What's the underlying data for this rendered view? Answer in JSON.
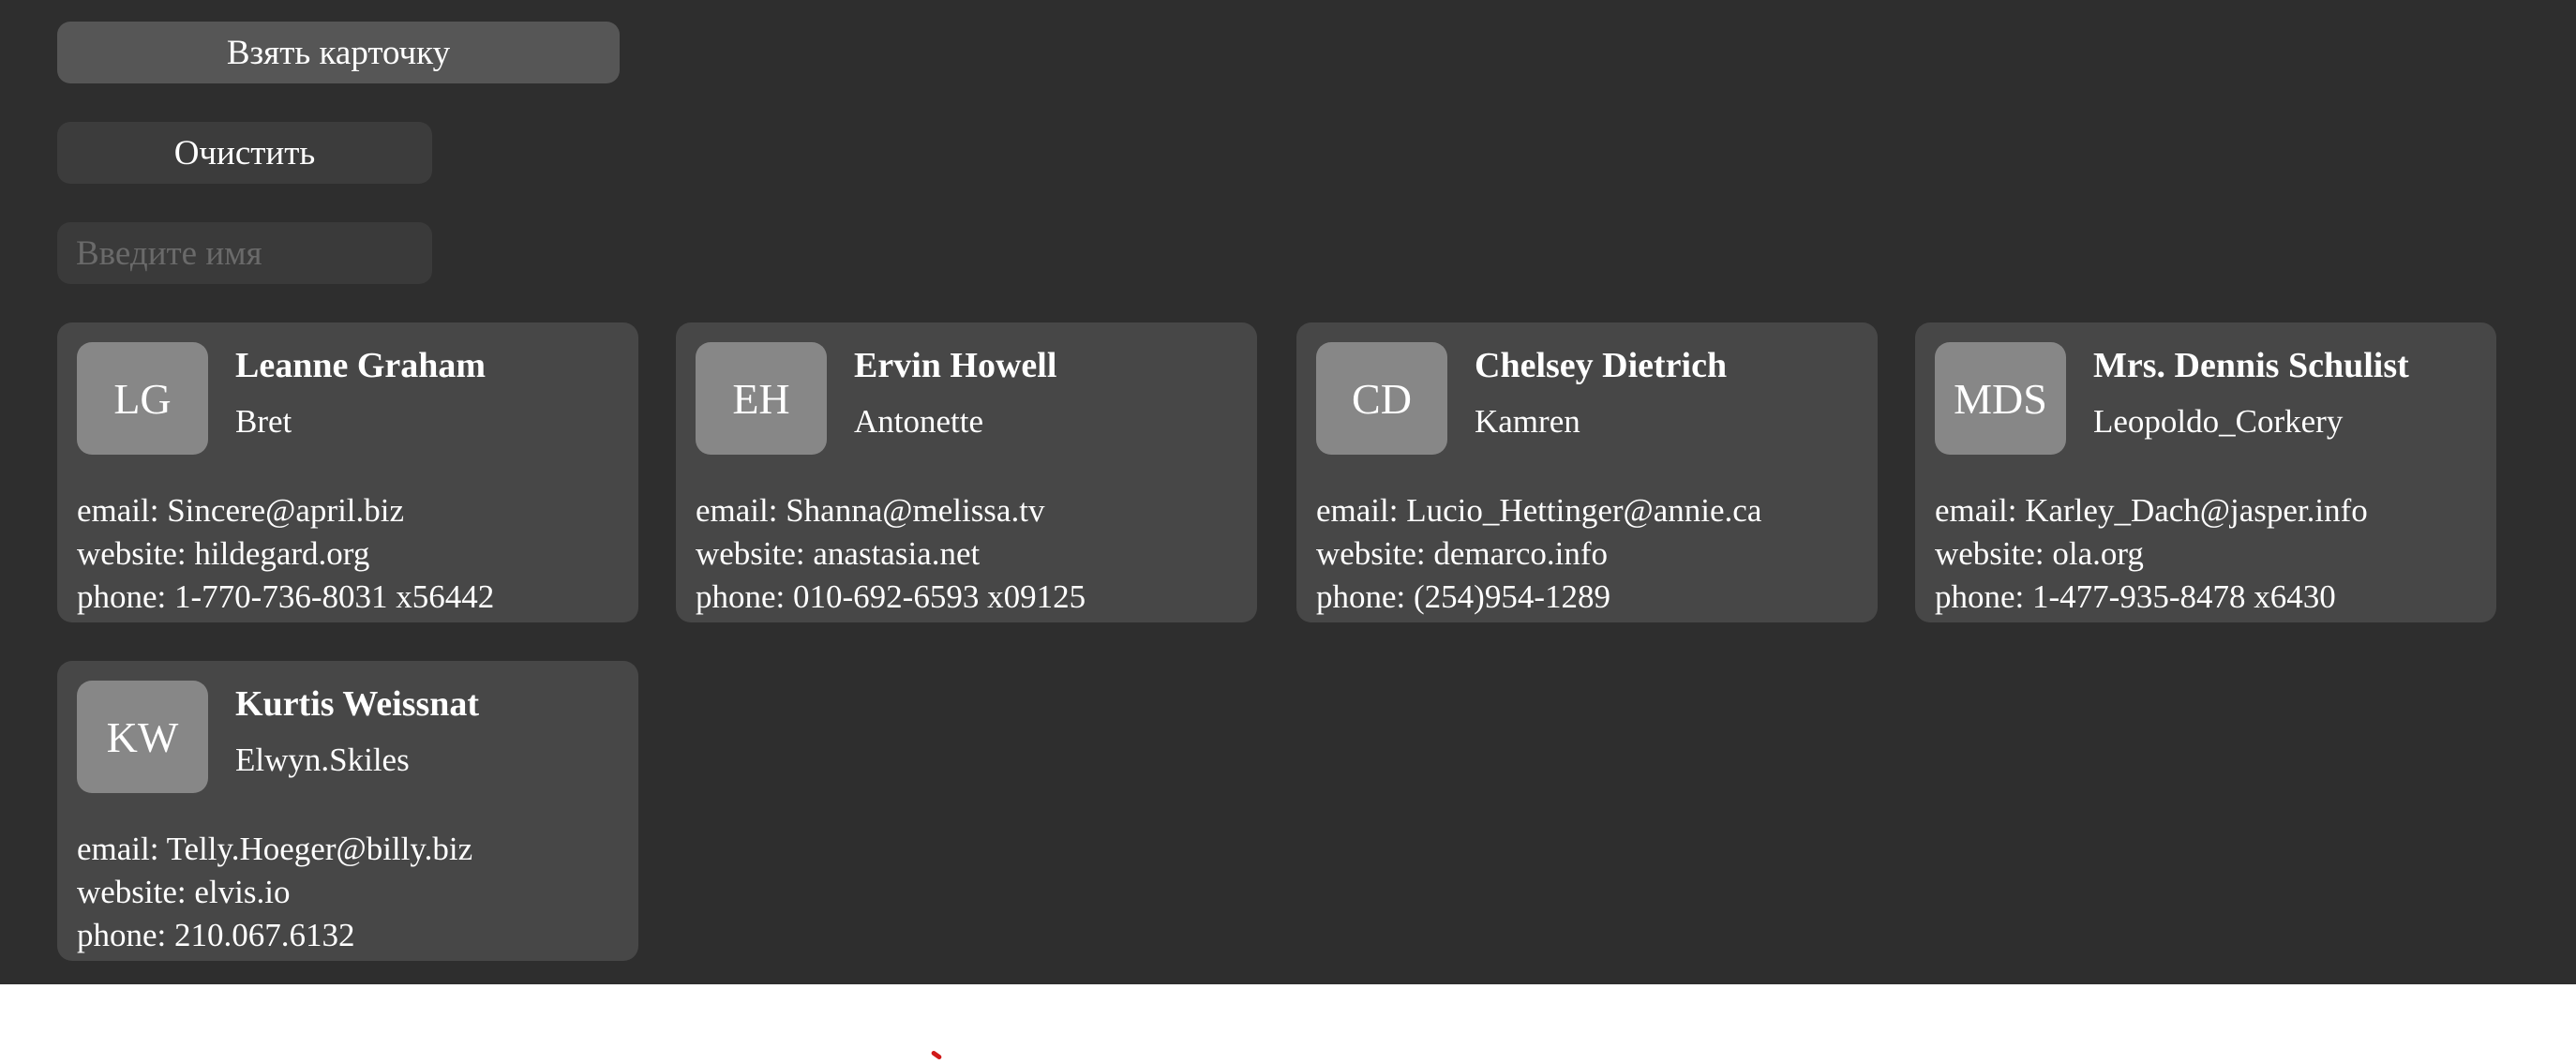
{
  "controls": {
    "take_card_label": "Взять карточку",
    "clear_label": "Очистить",
    "name_input_placeholder": "Введите имя",
    "name_input_value": ""
  },
  "cards": [
    {
      "initials": "LG",
      "name": "Leanne Graham",
      "username": "Bret",
      "email": "email: Sincere@april.biz",
      "website": "website: hildegard.org",
      "phone": "phone: 1-770-736-8031 x56442"
    },
    {
      "initials": "EH",
      "name": "Ervin Howell",
      "username": "Antonette",
      "email": "email: Shanna@melissa.tv",
      "website": "website: anastasia.net",
      "phone": "phone: 010-692-6593 x09125"
    },
    {
      "initials": "CD",
      "name": "Chelsey Dietrich",
      "username": "Kamren",
      "email": "email: Lucio_Hettinger@annie.ca",
      "website": "website: demarco.info",
      "phone": "phone: (254)954-1289"
    },
    {
      "initials": "MDS",
      "name": "Mrs. Dennis Schulist",
      "username": "Leopoldo_Corkery",
      "email": "email: Karley_Dach@jasper.info",
      "website": "website: ola.org",
      "phone": "phone: 1-477-935-8478 x6430"
    },
    {
      "initials": "KW",
      "name": "Kurtis Weissnat",
      "username": "Elwyn.Skiles",
      "email": "email: Telly.Hoeger@billy.biz",
      "website": "website: elvis.io",
      "phone": "phone: 210.067.6132"
    }
  ],
  "colors": {
    "app_background": "#2e2e2e",
    "card_background": "#474747",
    "avatar_background": "#878787",
    "primary_button": "#565656",
    "secondary_button": "#3c3c3c",
    "loader_accent": "#d11a1a"
  },
  "icons": {
    "loader": "spinner-icon"
  }
}
